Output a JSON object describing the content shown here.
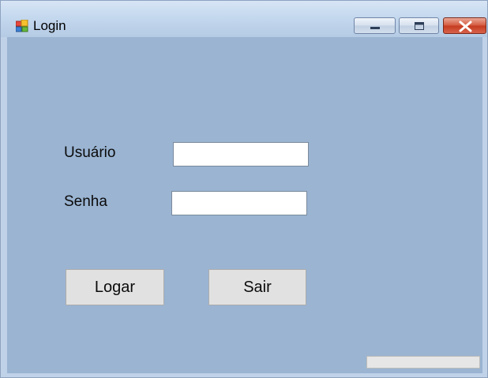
{
  "window": {
    "title": "Login",
    "app_icon": "windows-form-icon",
    "controls": {
      "minimize_icon": "minimize-icon",
      "maximize_icon": "maximize-icon",
      "close_icon": "close-icon"
    }
  },
  "form": {
    "user_label": "Usuário",
    "user_value": "",
    "password_label": "Senha",
    "password_value": "",
    "login_button": "Logar",
    "exit_button": "Sair",
    "progress": 0
  },
  "colors": {
    "client_background": "#9ab4d2",
    "close_button": "#c43b1e",
    "button_face": "#e1e1e1"
  }
}
